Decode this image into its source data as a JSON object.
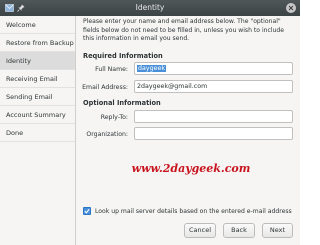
{
  "window": {
    "title": "Identity"
  },
  "sidebar": {
    "items": [
      {
        "label": "Welcome"
      },
      {
        "label": "Restore from Backup"
      },
      {
        "label": "Identity"
      },
      {
        "label": "Receiving Email"
      },
      {
        "label": "Sending Email"
      },
      {
        "label": "Account Summary"
      },
      {
        "label": "Done"
      }
    ],
    "active": "Identity"
  },
  "main": {
    "intro": "Please enter your name and email address below. The \"optional\" fields below do not need to be filled in, unless you wish to include this information in email you send.",
    "required_heading": "Required Information",
    "full_name": {
      "label": "Full Name:",
      "value": "daygeek"
    },
    "email": {
      "label": "Email Address:",
      "value": "2daygeek@gmail.com"
    },
    "optional_heading": "Optional Information",
    "reply_to": {
      "label": "Reply-To:",
      "value": ""
    },
    "organization": {
      "label": "Organization:",
      "value": ""
    },
    "watermark": "www.2daygeek.com",
    "lookup_checkbox": {
      "label": "Look up mail server details based on the entered e-mail address",
      "checked": true
    }
  },
  "buttons": {
    "cancel": "Cancel",
    "back": "Back",
    "next": "Next"
  },
  "colors": {
    "accent": "#4a90d9",
    "titlebar": "#3f4648",
    "watermark": "#c8141e"
  },
  "icons": {
    "titlebar_left": [
      "mail-icon",
      "pin-icon"
    ],
    "close": "close-icon"
  }
}
